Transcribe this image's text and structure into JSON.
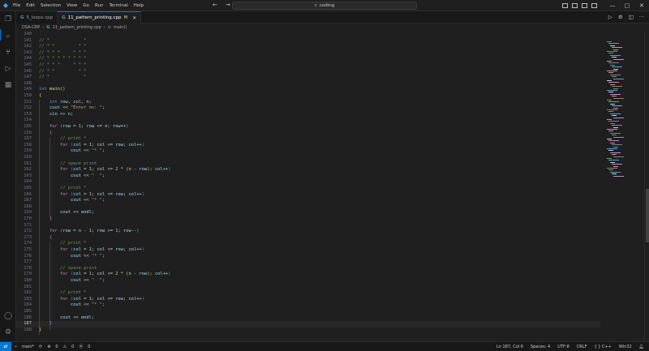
{
  "titlebar": {
    "menu": [
      "File",
      "Edit",
      "Selection",
      "View",
      "Go",
      "Run",
      "Terminal",
      "Help"
    ],
    "search_text": "coding"
  },
  "tabs": [
    {
      "label": "5_loops.cpp",
      "icon": "cpp-file-icon"
    },
    {
      "label": "11_pattern_printing.cpp",
      "modified": "M",
      "icon": "cpp-file-icon"
    }
  ],
  "breadcrumb": {
    "folder": "DSA-CRP",
    "file": "11_pattern_printing.cpp",
    "symbol": "main()"
  },
  "editor": {
    "lines": [
      {
        "n": "140",
        "t": [
          [
            "",
            ""
          ]
        ]
      },
      {
        "n": "141",
        "t": [
          [
            "c",
            "// *             *"
          ]
        ]
      },
      {
        "n": "142",
        "t": [
          [
            "c",
            "// * *         * *"
          ]
        ]
      },
      {
        "n": "143",
        "t": [
          [
            "c",
            "// * * *     * * *"
          ]
        ]
      },
      {
        "n": "144",
        "t": [
          [
            "c",
            "// * * * * * * * *"
          ]
        ]
      },
      {
        "n": "145",
        "t": [
          [
            "c",
            "// * * *     * * *"
          ]
        ]
      },
      {
        "n": "146",
        "t": [
          [
            "c",
            "// * *         * *"
          ]
        ]
      },
      {
        "n": "147",
        "t": [
          [
            "c",
            "// *             *"
          ]
        ]
      },
      {
        "n": "148",
        "t": [
          [
            "",
            ""
          ]
        ]
      },
      {
        "n": "149",
        "t": [
          [
            "k",
            "int "
          ],
          [
            "f",
            "main"
          ],
          [
            "b1",
            "()"
          ]
        ]
      },
      {
        "n": "150",
        "t": [
          [
            "b1",
            "{"
          ]
        ]
      },
      {
        "n": "151",
        "t": [
          [
            "",
            "    "
          ],
          [
            "k",
            "int "
          ],
          [
            "v",
            "row"
          ],
          [
            "",
            ", "
          ],
          [
            "v",
            "col"
          ],
          [
            "",
            ", "
          ],
          [
            "v",
            "n"
          ],
          [
            "",
            ";"
          ]
        ]
      },
      {
        "n": "152",
        "t": [
          [
            "",
            "    "
          ],
          [
            "v",
            "cout"
          ],
          [
            "",
            " << "
          ],
          [
            "s",
            "\"Enter no: \""
          ],
          [
            "",
            ";"
          ]
        ]
      },
      {
        "n": "153",
        "t": [
          [
            "",
            "    "
          ],
          [
            "v",
            "cin"
          ],
          [
            "",
            " >> "
          ],
          [
            "v",
            "n"
          ],
          [
            "",
            ";"
          ]
        ]
      },
      {
        "n": "154",
        "t": [
          [
            "",
            ""
          ]
        ]
      },
      {
        "n": "155",
        "t": [
          [
            "",
            "    "
          ],
          [
            "x",
            "for "
          ],
          [
            "b2",
            "("
          ],
          [
            "v",
            "row"
          ],
          [
            "",
            " = "
          ],
          [
            "m",
            "1"
          ],
          [
            "",
            "; "
          ],
          [
            "v",
            "row"
          ],
          [
            "",
            " <= "
          ],
          [
            "v",
            "n"
          ],
          [
            "",
            "; "
          ],
          [
            "v",
            "row"
          ],
          [
            "",
            "++"
          ],
          [
            "b2",
            ")"
          ]
        ]
      },
      {
        "n": "156",
        "t": [
          [
            "",
            "    "
          ],
          [
            "b2",
            "{"
          ]
        ]
      },
      {
        "n": "157",
        "t": [
          [
            "",
            "        "
          ],
          [
            "c",
            "// print *"
          ]
        ]
      },
      {
        "n": "158",
        "t": [
          [
            "",
            "        "
          ],
          [
            "x",
            "for "
          ],
          [
            "b3",
            "("
          ],
          [
            "v",
            "col"
          ],
          [
            "",
            " = "
          ],
          [
            "m",
            "1"
          ],
          [
            "",
            "; "
          ],
          [
            "v",
            "col"
          ],
          [
            "",
            " <= "
          ],
          [
            "v",
            "row"
          ],
          [
            "",
            "; "
          ],
          [
            "v",
            "col"
          ],
          [
            "",
            "++"
          ],
          [
            "b3",
            ")"
          ]
        ]
      },
      {
        "n": "159",
        "t": [
          [
            "",
            "            "
          ],
          [
            "v",
            "cout"
          ],
          [
            "",
            " << "
          ],
          [
            "s",
            "\"* \""
          ],
          [
            "",
            ";"
          ]
        ]
      },
      {
        "n": "160",
        "t": [
          [
            "",
            ""
          ]
        ]
      },
      {
        "n": "161",
        "t": [
          [
            "",
            "        "
          ],
          [
            "c",
            "// space print"
          ]
        ]
      },
      {
        "n": "162",
        "t": [
          [
            "",
            "        "
          ],
          [
            "x",
            "for "
          ],
          [
            "b3",
            "("
          ],
          [
            "v",
            "col"
          ],
          [
            "",
            " = "
          ],
          [
            "m",
            "1"
          ],
          [
            "",
            "; "
          ],
          [
            "v",
            "col"
          ],
          [
            "",
            " <= "
          ],
          [
            "m",
            "2"
          ],
          [
            "",
            " * "
          ],
          [
            "b1",
            "("
          ],
          [
            "v",
            "n"
          ],
          [
            "",
            " - "
          ],
          [
            "v",
            "row"
          ],
          [
            "b1",
            ")"
          ],
          [
            "",
            "; "
          ],
          [
            "v",
            "col"
          ],
          [
            "",
            "++"
          ],
          [
            "b3",
            ")"
          ]
        ]
      },
      {
        "n": "163",
        "t": [
          [
            "",
            "            "
          ],
          [
            "v",
            "cout"
          ],
          [
            "",
            " << "
          ],
          [
            "s",
            "\"  \""
          ],
          [
            "",
            ";"
          ]
        ]
      },
      {
        "n": "164",
        "t": [
          [
            "",
            ""
          ]
        ]
      },
      {
        "n": "165",
        "t": [
          [
            "",
            "        "
          ],
          [
            "c",
            "// print *"
          ]
        ]
      },
      {
        "n": "166",
        "t": [
          [
            "",
            "        "
          ],
          [
            "x",
            "for "
          ],
          [
            "b3",
            "("
          ],
          [
            "v",
            "col"
          ],
          [
            "",
            " = "
          ],
          [
            "m",
            "1"
          ],
          [
            "",
            "; "
          ],
          [
            "v",
            "col"
          ],
          [
            "",
            " <= "
          ],
          [
            "v",
            "row"
          ],
          [
            "",
            "; "
          ],
          [
            "v",
            "col"
          ],
          [
            "",
            "++"
          ],
          [
            "b3",
            ")"
          ]
        ]
      },
      {
        "n": "167",
        "t": [
          [
            "",
            "            "
          ],
          [
            "v",
            "cout"
          ],
          [
            "",
            " << "
          ],
          [
            "s",
            "\"* \""
          ],
          [
            "",
            ";"
          ]
        ]
      },
      {
        "n": "168",
        "t": [
          [
            "",
            ""
          ]
        ]
      },
      {
        "n": "169",
        "t": [
          [
            "",
            "        "
          ],
          [
            "v",
            "cout"
          ],
          [
            "",
            " << "
          ],
          [
            "v",
            "endl"
          ],
          [
            "",
            ";"
          ]
        ]
      },
      {
        "n": "170",
        "t": [
          [
            "",
            "    "
          ],
          [
            "b2",
            "}"
          ]
        ]
      },
      {
        "n": "171",
        "t": [
          [
            "",
            ""
          ]
        ]
      },
      {
        "n": "172",
        "t": [
          [
            "",
            "    "
          ],
          [
            "x",
            "for "
          ],
          [
            "b2",
            "("
          ],
          [
            "v",
            "row"
          ],
          [
            "",
            " = "
          ],
          [
            "v",
            "n"
          ],
          [
            "",
            " - "
          ],
          [
            "m",
            "1"
          ],
          [
            "",
            "; "
          ],
          [
            "v",
            "row"
          ],
          [
            "",
            " >= "
          ],
          [
            "m",
            "1"
          ],
          [
            "",
            "; "
          ],
          [
            "v",
            "row"
          ],
          [
            "",
            "--"
          ],
          [
            "b2",
            ")"
          ]
        ]
      },
      {
        "n": "173",
        "t": [
          [
            "",
            "    "
          ],
          [
            "b2",
            "{"
          ]
        ]
      },
      {
        "n": "174",
        "t": [
          [
            "",
            "        "
          ],
          [
            "c",
            "// print *"
          ]
        ]
      },
      {
        "n": "175",
        "t": [
          [
            "",
            "        "
          ],
          [
            "x",
            "for "
          ],
          [
            "b3",
            "("
          ],
          [
            "v",
            "col"
          ],
          [
            "",
            " = "
          ],
          [
            "m",
            "1"
          ],
          [
            "",
            "; "
          ],
          [
            "v",
            "col"
          ],
          [
            "",
            " <= "
          ],
          [
            "v",
            "row"
          ],
          [
            "",
            "; "
          ],
          [
            "v",
            "col"
          ],
          [
            "",
            "++"
          ],
          [
            "b3",
            ")"
          ]
        ]
      },
      {
        "n": "176",
        "t": [
          [
            "",
            "            "
          ],
          [
            "v",
            "cout"
          ],
          [
            "",
            " << "
          ],
          [
            "s",
            "\"* \""
          ],
          [
            "",
            ";"
          ]
        ]
      },
      {
        "n": "177",
        "t": [
          [
            "",
            ""
          ]
        ]
      },
      {
        "n": "178",
        "t": [
          [
            "",
            "        "
          ],
          [
            "c",
            "// space print"
          ]
        ]
      },
      {
        "n": "179",
        "t": [
          [
            "",
            "        "
          ],
          [
            "x",
            "for "
          ],
          [
            "b3",
            "("
          ],
          [
            "v",
            "col"
          ],
          [
            "",
            " = "
          ],
          [
            "m",
            "1"
          ],
          [
            "",
            "; "
          ],
          [
            "v",
            "col"
          ],
          [
            "",
            " <= "
          ],
          [
            "m",
            "2"
          ],
          [
            "",
            " * "
          ],
          [
            "b1",
            "("
          ],
          [
            "v",
            "n"
          ],
          [
            "",
            " - "
          ],
          [
            "v",
            "row"
          ],
          [
            "b1",
            ")"
          ],
          [
            "",
            "; "
          ],
          [
            "v",
            "col"
          ],
          [
            "",
            "++"
          ],
          [
            "b3",
            ")"
          ]
        ]
      },
      {
        "n": "180",
        "t": [
          [
            "",
            "            "
          ],
          [
            "v",
            "cout"
          ],
          [
            "",
            " << "
          ],
          [
            "s",
            "\"  \""
          ],
          [
            "",
            ";"
          ]
        ]
      },
      {
        "n": "181",
        "t": [
          [
            "",
            ""
          ]
        ]
      },
      {
        "n": "182",
        "t": [
          [
            "",
            "        "
          ],
          [
            "c",
            "// print *"
          ]
        ]
      },
      {
        "n": "183",
        "t": [
          [
            "",
            "        "
          ],
          [
            "x",
            "for "
          ],
          [
            "b3",
            "("
          ],
          [
            "v",
            "col"
          ],
          [
            "",
            " = "
          ],
          [
            "m",
            "1"
          ],
          [
            "",
            "; "
          ],
          [
            "v",
            "col"
          ],
          [
            "",
            " <= "
          ],
          [
            "v",
            "row"
          ],
          [
            "",
            "; "
          ],
          [
            "v",
            "col"
          ],
          [
            "",
            "++"
          ],
          [
            "b3",
            ")"
          ]
        ]
      },
      {
        "n": "184",
        "t": [
          [
            "",
            "            "
          ],
          [
            "v",
            "cout"
          ],
          [
            "",
            " << "
          ],
          [
            "s",
            "\"* \""
          ],
          [
            "",
            ";"
          ]
        ]
      },
      {
        "n": "185",
        "t": [
          [
            "",
            ""
          ]
        ]
      },
      {
        "n": "186",
        "t": [
          [
            "",
            "        "
          ],
          [
            "v",
            "cout"
          ],
          [
            "",
            " << "
          ],
          [
            "v",
            "endl"
          ],
          [
            "",
            ";"
          ]
        ]
      },
      {
        "n": "187",
        "t": [
          [
            "",
            "    "
          ],
          [
            "b2",
            "}"
          ]
        ],
        "current": true
      },
      {
        "n": "188",
        "t": [
          [
            "b1",
            "}"
          ]
        ]
      }
    ]
  },
  "statusbar": {
    "branch": "main*",
    "errors": "0",
    "warnings": "0",
    "ports": "0",
    "cursor": "Ln 187, Col 6",
    "spaces": "Spaces: 4",
    "encoding": "UTF-8",
    "eol": "CRLF",
    "language": "C++",
    "platform": "Win32"
  },
  "colors": {
    "accent": "#0078d4",
    "background": "#1f1f1f",
    "comment": "#6a9955",
    "keyword": "#569cd6",
    "string": "#ce9178"
  }
}
